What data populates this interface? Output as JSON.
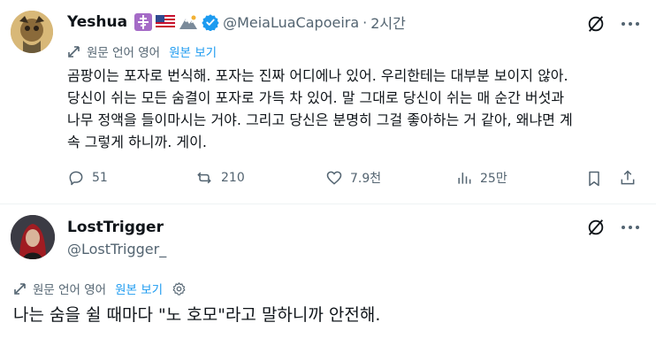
{
  "post": {
    "author_name": "Yeshua",
    "emoji_icons": [
      "orthodox-cross-icon",
      "us-flag-icon",
      "mountain-icon"
    ],
    "verified_color": "#1d9bf0",
    "handle": "@MeiaLuaCapoeira",
    "separator": "·",
    "time": "2시간",
    "translate_label": "원문 언어 영어",
    "translate_link": "원본 보기",
    "body_lines": [
      "곰팡이는 포자로 번식해. 포자는 진짜 어디에나 있어. 우리한테는 대부분 보이지 않아.",
      "당신이 쉬는 모든 숨결이 포자로 가득 차 있어. 말 그대로 당신이 쉬는 매 순간 버섯과",
      "나무 정액을 들이마시는 거야. 그리고 당신은 분명히 그걸 좋아하는 거 같아, 왜냐면 계",
      "속 그렇게 하니까. 게이."
    ],
    "actions": {
      "replies": "51",
      "reposts": "210",
      "likes": "7.9천",
      "views": "25만"
    }
  },
  "reply": {
    "author_name": "LostTrigger",
    "handle": "@LostTrigger_",
    "translate_label": "원문 언어 영어",
    "translate_link": "원본 보기",
    "body": "나는 숨을 쉴 때마다 \"노 호모\"라고 말하니까 안전해."
  },
  "colors": {
    "text": "#0f1419",
    "muted": "#536471",
    "accent": "#1d9bf0",
    "divider": "#eff3f4"
  }
}
